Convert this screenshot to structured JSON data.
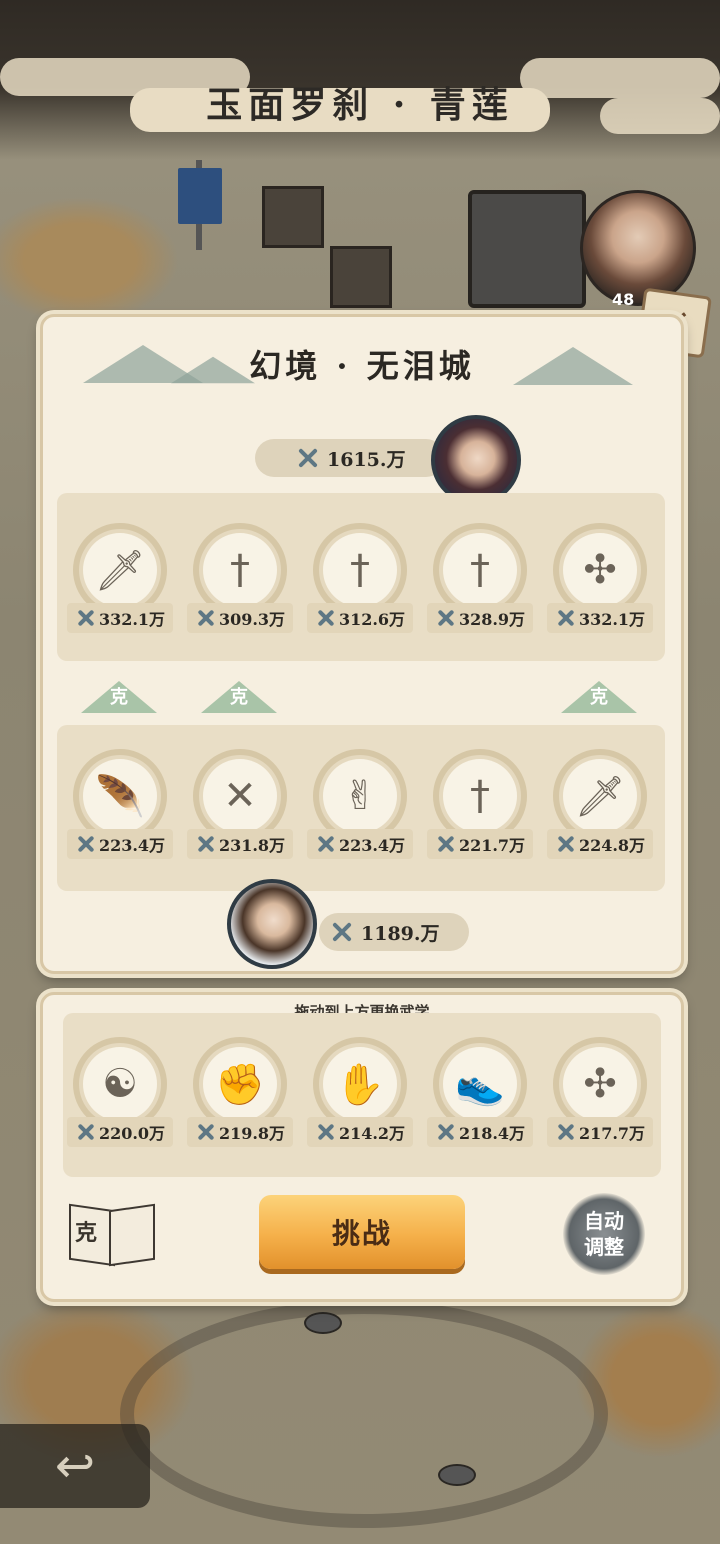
{
  "header": {
    "title": "玉面罗刹 · 青莲"
  },
  "boss_marker": {
    "count_text": "48"
  },
  "stage": {
    "title": "幻境 · 无泪城"
  },
  "enemy": {
    "power": "1615.万",
    "skills": [
      {
        "icon": "saber-icon",
        "glyph": "🗡",
        "power": "332.1万"
      },
      {
        "icon": "sword-icon",
        "glyph": "†",
        "power": "309.3万"
      },
      {
        "icon": "sword-icon",
        "glyph": "†",
        "power": "312.6万"
      },
      {
        "icon": "sword-icon",
        "glyph": "†",
        "power": "328.9万"
      },
      {
        "icon": "throwing-knives-icon",
        "glyph": "✣",
        "power": "332.1万"
      }
    ]
  },
  "counters": {
    "label": "克"
  },
  "player": {
    "power": "1189.万",
    "skills": [
      {
        "icon": "feather-icon",
        "glyph": "🪶",
        "power": "223.4万"
      },
      {
        "icon": "crossed-spears-icon",
        "glyph": "✕",
        "power": "231.8万"
      },
      {
        "icon": "finger-gesture-icon",
        "glyph": "✌",
        "power": "223.4万"
      },
      {
        "icon": "sword-icon",
        "glyph": "†",
        "power": "221.7万"
      },
      {
        "icon": "saber-icon",
        "glyph": "🗡",
        "power": "224.8万"
      }
    ]
  },
  "inventory": {
    "hint": "拖动到上方更换武学",
    "skills": [
      {
        "icon": "meditation-icon",
        "glyph": "☯",
        "power": "220.0万"
      },
      {
        "icon": "fist-icon",
        "glyph": "✊",
        "power": "219.8万"
      },
      {
        "icon": "palm-icon",
        "glyph": "✋",
        "power": "214.2万"
      },
      {
        "icon": "shoe-icon",
        "glyph": "👟",
        "power": "218.4万"
      },
      {
        "icon": "throwing-knives-icon",
        "glyph": "✣",
        "power": "217.7万"
      }
    ]
  },
  "buttons": {
    "challenge": "挑战",
    "auto_adjust_line1": "自动",
    "auto_adjust_line2": "调整",
    "counter_book": "克",
    "back": "↩"
  }
}
